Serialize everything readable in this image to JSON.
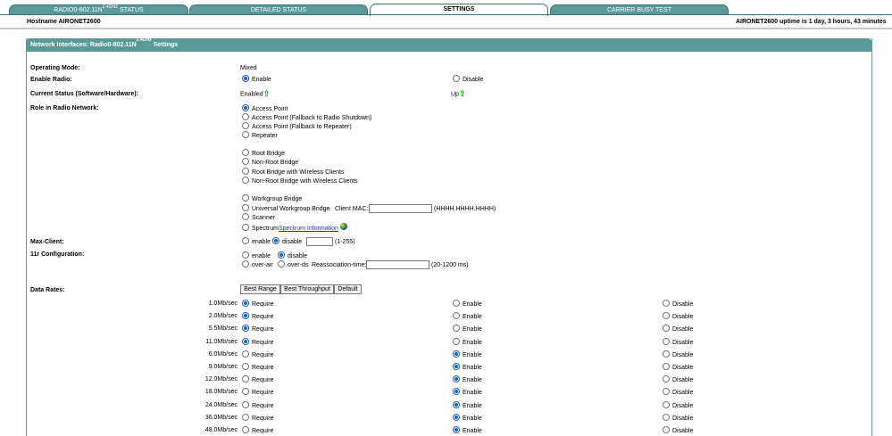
{
  "tabs": [
    {
      "label": "RADIO0-802.11N",
      "sup": "2.4GHZ",
      "suffix": " STATUS"
    },
    {
      "label": "DETAILED STATUS"
    },
    {
      "label": "SETTINGS"
    },
    {
      "label": "CARRIER BUSY TEST"
    }
  ],
  "header": {
    "hostname": "Hostname  AIRONET2600",
    "uptime": "AIRONET2600 uptime is 1 day, 3 hours, 43 minutes"
  },
  "panel": {
    "title_prefix": "Network Interfaces: Radio0-802.11N",
    "title_sup": "2.4GHz",
    "title_suffix": " Settings"
  },
  "operating_mode": {
    "label": "Operating Mode:",
    "value": "Mixed"
  },
  "enable_radio": {
    "label": "Enable Radio:",
    "enable": "Enable",
    "disable": "Disable"
  },
  "current_status": {
    "label": "Current Status (Software/Hardware):",
    "software": "Enabled",
    "hardware": "Up"
  },
  "role": {
    "label": "Role in Radio Network:",
    "options": [
      "Access Point",
      "Access Point (Fallback to Radio Shutdown)",
      "Access Point (Fallback to Repeater)",
      "Repeater",
      "Root Bridge",
      "Non-Root Bridge",
      "Root Bridge with Wireless Clients",
      "Non-Root Bridge with Wireless Clients",
      "Workgroup Bridge",
      "Universal Workgroup Bridge",
      "Scanner",
      "Spectrum"
    ],
    "client_mac_label": "Client MAC:",
    "client_mac_hint": "(HHHH.HHHH.HHHH)",
    "spectrum_link": "Spectrum Information"
  },
  "max_client": {
    "label": "Max-Client:",
    "enable": "enable",
    "disable": "disable",
    "hint": "(1-255)"
  },
  "r11_config": {
    "label": "11r Configuration:",
    "enable": "enable",
    "disable": "disable",
    "over_air": "over-air",
    "over_ds": "over-ds",
    "reassoc_label": "Reassociation-time:",
    "reassoc_hint": "(20-1200 ms)"
  },
  "data_rates": {
    "label": "Data Rates:",
    "buttons": [
      "Best Range",
      "Best Throughput",
      "Default"
    ],
    "require": "Require",
    "enable": "Enable",
    "disable": "Disable",
    "rows": [
      {
        "rate": "1.0Mb/sec",
        "selected": "require"
      },
      {
        "rate": "2.0Mb/sec",
        "selected": "require"
      },
      {
        "rate": "5.5Mb/sec",
        "selected": "require"
      },
      {
        "rate": "11.0Mb/sec",
        "selected": "require"
      },
      {
        "rate": "6.0Mb/sec",
        "selected": "enable"
      },
      {
        "rate": "9.0Mb/sec",
        "selected": "enable"
      },
      {
        "rate": "12.0Mb/sec",
        "selected": "enable"
      },
      {
        "rate": "18.0Mb/sec",
        "selected": "enable"
      },
      {
        "rate": "24.0Mb/sec",
        "selected": "enable"
      },
      {
        "rate": "36.0Mb/sec",
        "selected": "enable"
      },
      {
        "rate": "48.0Mb/sec",
        "selected": "enable"
      }
    ]
  },
  "colors": {
    "tab_bg": "#5b9999",
    "panel_head": "#5b9999",
    "status_arrow": "#1fb01f",
    "link": "#1a3ea8"
  }
}
